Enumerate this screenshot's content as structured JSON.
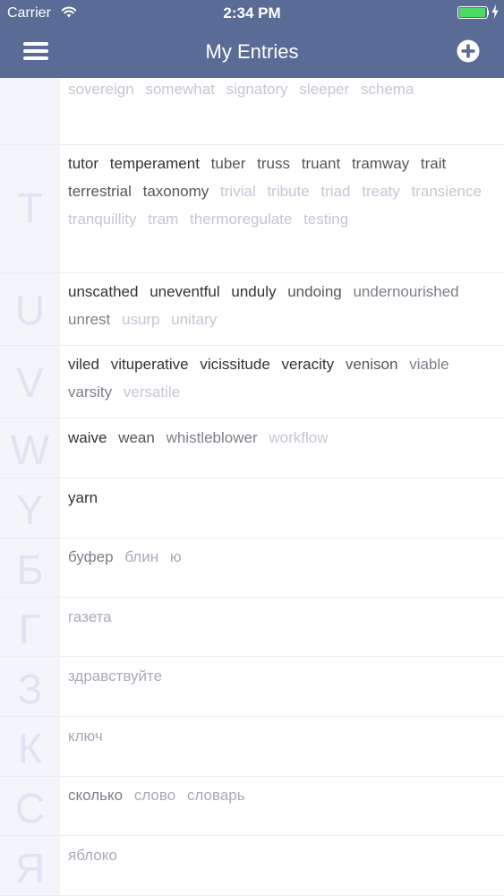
{
  "status_bar": {
    "carrier": "Carrier",
    "time": "2:34 PM",
    "battery_color": "#4cd964",
    "battery_level": 1.0
  },
  "header": {
    "title": "My Entries",
    "menu_icon": "hamburger-menu-icon",
    "add_icon": "add-circle-icon",
    "background": "#5a6b96"
  },
  "sections": [
    {
      "letter": "",
      "words": [
        {
          "text": "sovereign",
          "shade": 4
        },
        {
          "text": "somewhat",
          "shade": 4
        },
        {
          "text": "signatory",
          "shade": 4
        },
        {
          "text": "sleeper",
          "shade": 4
        },
        {
          "text": "schema",
          "shade": 4
        }
      ]
    },
    {
      "letter": "T",
      "words": [
        {
          "text": "tutor",
          "shade": 0
        },
        {
          "text": "temperament",
          "shade": 0
        },
        {
          "text": "tuber",
          "shade": 1
        },
        {
          "text": "truss",
          "shade": 1
        },
        {
          "text": "truant",
          "shade": 1
        },
        {
          "text": "tramway",
          "shade": 1
        },
        {
          "text": "trait",
          "shade": 1
        },
        {
          "text": "terrestrial",
          "shade": 1
        },
        {
          "text": "taxonomy",
          "shade": 1
        },
        {
          "text": "trivial",
          "shade": 4
        },
        {
          "text": "tribute",
          "shade": 4
        },
        {
          "text": "triad",
          "shade": 4
        },
        {
          "text": "treaty",
          "shade": 4
        },
        {
          "text": "transience",
          "shade": 4
        },
        {
          "text": "tranquillity",
          "shade": 4
        },
        {
          "text": "tram",
          "shade": 4
        },
        {
          "text": "thermoregulate",
          "shade": 4
        },
        {
          "text": "testing",
          "shade": 4
        }
      ]
    },
    {
      "letter": "U",
      "words": [
        {
          "text": "unscathed",
          "shade": 0
        },
        {
          "text": "uneventful",
          "shade": 0
        },
        {
          "text": "unduly",
          "shade": 0
        },
        {
          "text": "undoing",
          "shade": 1
        },
        {
          "text": "undernourished",
          "shade": 2
        },
        {
          "text": "unrest",
          "shade": 2
        },
        {
          "text": "usurp",
          "shade": 4
        },
        {
          "text": "unitary",
          "shade": 4
        }
      ]
    },
    {
      "letter": "V",
      "words": [
        {
          "text": "viled",
          "shade": 0
        },
        {
          "text": "vituperative",
          "shade": 0
        },
        {
          "text": "vicissitude",
          "shade": 0
        },
        {
          "text": "veracity",
          "shade": 0
        },
        {
          "text": "venison",
          "shade": 1
        },
        {
          "text": "viable",
          "shade": 2
        },
        {
          "text": "varsity",
          "shade": 2
        },
        {
          "text": "versatile",
          "shade": 4
        }
      ]
    },
    {
      "letter": "W",
      "words": [
        {
          "text": "waive",
          "shade": 0
        },
        {
          "text": "wean",
          "shade": 1
        },
        {
          "text": "whistleblower",
          "shade": 2
        },
        {
          "text": "workflow",
          "shade": 4
        }
      ]
    },
    {
      "letter": "Y",
      "words": [
        {
          "text": "yarn",
          "shade": 0
        }
      ]
    },
    {
      "letter": "Б",
      "words": [
        {
          "text": "буфер",
          "shade": 2
        },
        {
          "text": "блин",
          "shade": 3
        },
        {
          "text": "ю",
          "shade": 3
        }
      ]
    },
    {
      "letter": "Г",
      "words": [
        {
          "text": "газета",
          "shade": 3
        }
      ]
    },
    {
      "letter": "З",
      "words": [
        {
          "text": "здравствуйте",
          "shade": 3
        }
      ]
    },
    {
      "letter": "К",
      "words": [
        {
          "text": "ключ",
          "shade": 3
        }
      ]
    },
    {
      "letter": "С",
      "words": [
        {
          "text": "сколько",
          "shade": 2
        },
        {
          "text": "слово",
          "shade": 3
        },
        {
          "text": "словарь",
          "shade": 3
        }
      ]
    },
    {
      "letter": "Я",
      "words": [
        {
          "text": "яблоко",
          "shade": 3
        }
      ]
    }
  ]
}
